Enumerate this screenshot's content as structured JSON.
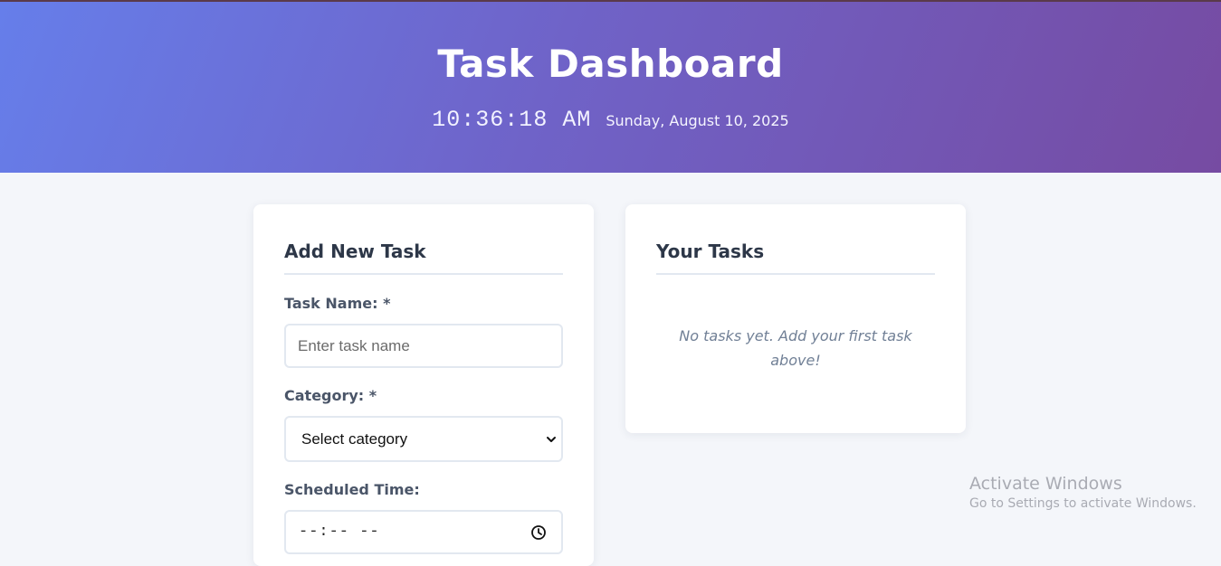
{
  "header": {
    "title": "Task Dashboard",
    "time": "10:36:18 AM",
    "date": "Sunday, August 10, 2025"
  },
  "add_task": {
    "title": "Add New Task",
    "task_name_label": "Task Name: *",
    "task_name_placeholder": "Enter task name",
    "task_name_value": "",
    "category_label": "Category: *",
    "category_selected": "Select category",
    "scheduled_time_label": "Scheduled Time:",
    "scheduled_time_value": "--:-- --"
  },
  "tasks": {
    "title": "Your Tasks",
    "empty_message": "No tasks yet. Add your first task above!"
  },
  "watermark": {
    "line1": "Activate Windows",
    "line2": "Go to Settings to activate Windows."
  },
  "icons": {
    "dropdown": "chevron-down-icon",
    "time": "clock-icon"
  },
  "colors": {
    "header_gradient_start": "#667eea",
    "header_gradient_end": "#764ba2",
    "page_background": "#f4f6fa",
    "heading_text": "#2d3748",
    "label_text": "#4a5568",
    "muted_text": "#718096"
  }
}
